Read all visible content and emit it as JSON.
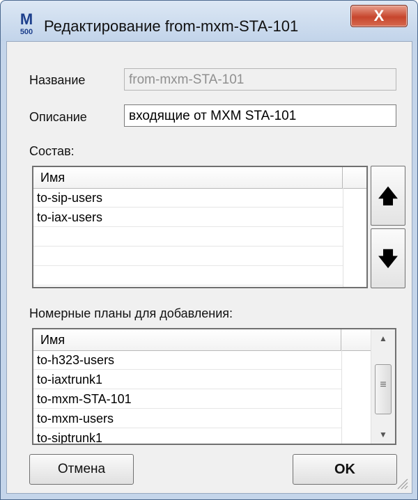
{
  "window": {
    "title": "Редактирование from-mxm-STA-101",
    "app_icon": {
      "top": "M",
      "bottom": "500"
    },
    "close_label": "X"
  },
  "form": {
    "name_label": "Название",
    "name_value": "from-mxm-STA-101",
    "description_label": "Описание",
    "description_value": "входящие от MXM STA-101"
  },
  "composition": {
    "label": "Состав:",
    "column_header": "Имя",
    "rows": [
      "to-sip-users",
      "to-iax-users"
    ],
    "move_up_icon": "arrow-up-icon",
    "move_down_icon": "arrow-down-icon"
  },
  "available": {
    "label": "Номерные планы для добавления:",
    "column_header": "Имя",
    "rows": [
      "to-h323-users",
      "to-iaxtrunk1",
      "to-mxm-STA-101",
      "to-mxm-users",
      "to-siptrunk1"
    ]
  },
  "buttons": {
    "cancel_label": "Отмена",
    "ok_label": "OK"
  },
  "colors": {
    "frame": "#c4d5ea",
    "close_button": "#c7462d",
    "client_bg": "#f0f0f0"
  }
}
